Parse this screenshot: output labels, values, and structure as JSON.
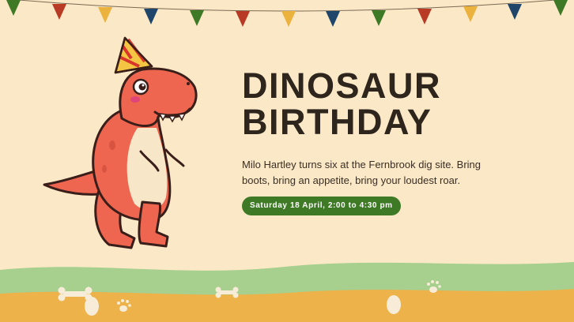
{
  "card": {
    "title_line1": "DINOSAUR",
    "title_line2": "BIRTHDAY",
    "description": "Milo Hartley turns six at the Fernbrook dig site. Bring boots, bring an appetite, bring your loudest roar.",
    "date_badge": "Saturday 18 April, 2:00 to 4:30 pm"
  },
  "colors": {
    "background": "#fbe8c6",
    "title": "#2e261d",
    "badge": "#3e7a26",
    "grass": "#a7cf8e",
    "sand": "#edb24a",
    "dino": "#ee6650",
    "flags": [
      "#3e7a26",
      "#b93a25",
      "#ecb23e",
      "#1f456b"
    ]
  },
  "icons": [
    "bunting-flags",
    "party-hat-icon",
    "dinosaur-illustration",
    "bone-icon",
    "paw-print-icon",
    "egg-icon"
  ]
}
